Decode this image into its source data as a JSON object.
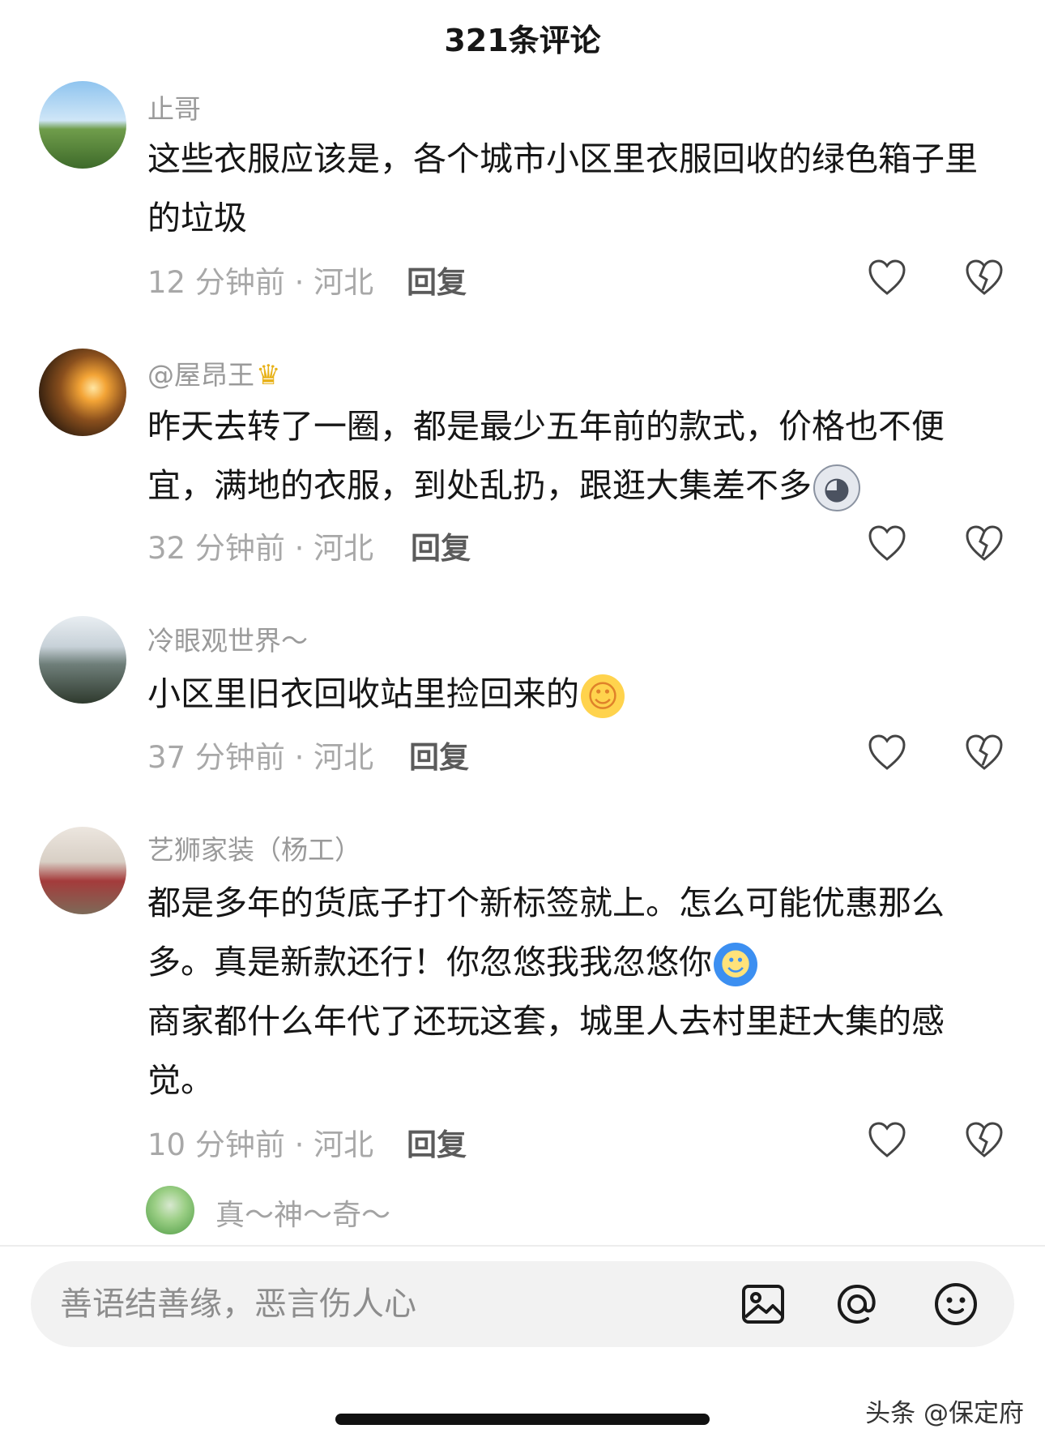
{
  "header": {
    "title": "321条评论"
  },
  "comments": [
    {
      "username": "止哥",
      "text": "这些衣服应该是，各个城市小区里衣服回收的绿色箱子里的垃圾",
      "meta": "12 分钟前 · 河北",
      "reply_label": "回复"
    },
    {
      "username": "@屋昂王",
      "username_emoji": "crown",
      "text": "昨天去转了一圈，都是最少五年前的款式，价格也不便宜，满地的衣服，到处乱扔，跟逛大集差不多",
      "text_emoji": "husky-emoji",
      "meta": "32 分钟前 · 河北",
      "reply_label": "回复"
    },
    {
      "username": "冷眼观世界～",
      "text": "小区里旧衣回收站里捡回来的",
      "text_emoji": "laughing-crying-emoji",
      "meta": "37 分钟前 · 河北",
      "reply_label": "回复"
    },
    {
      "username": "艺狮家装（杨工）",
      "text_line1": "都是多年的货底子打个新标签就上。怎么可能优惠那么多。真是新款还行！你忽悠我我忽悠你",
      "text_emoji": "blue-hair-emoji",
      "text_line2": "商家都什么年代了还玩这套，城里人去村里赶大集的感觉。",
      "meta": "10 分钟前 · 河北",
      "reply_label": "回复"
    }
  ],
  "next_comment": {
    "username": "真～神～奇～"
  },
  "input_bar": {
    "placeholder": "善语结善缘，恶言伤人心",
    "icons": [
      "image-icon",
      "at-icon",
      "emoji-icon"
    ]
  },
  "watermark": "头条 @保定府",
  "colors": {
    "username": "#9a9a9a",
    "meta": "#a8a8a8",
    "text": "#161616",
    "input_bg": "#f2f2f2"
  }
}
